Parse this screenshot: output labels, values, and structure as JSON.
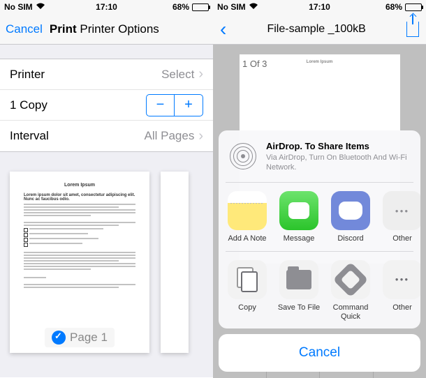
{
  "left": {
    "status": {
      "carrier": "No SIM",
      "time": "17:10",
      "battery": "68%"
    },
    "nav": {
      "cancel": "Cancel",
      "title": "Print",
      "subtitle": "Printer Options"
    },
    "rows": {
      "printer": {
        "label": "Printer",
        "value": "Select"
      },
      "copy": {
        "label": "1 Copy"
      },
      "interval": {
        "label": "Interval",
        "value": "All Pages"
      }
    },
    "preview": {
      "doc_title": "Lorem Ipsum",
      "heading": "Lorem ipsum dolor sit amet, consectetur adipiscing elit. Nunc ac faucibus odio.",
      "badge": "Page 1"
    }
  },
  "right": {
    "status": {
      "carrier": "No SIM",
      "time": "17:10",
      "battery": "68%"
    },
    "nav": {
      "title": "File-sample _100kB"
    },
    "doc": {
      "page_indicator": "1 Of 3",
      "title": "Lorem Ipsum"
    },
    "airdrop": {
      "title": "AirDrop. To Share Items",
      "desc": "Via AirDrop, Turn On Bluetooth And Wi-Fi Network."
    },
    "apps": [
      {
        "name": "Add A Note"
      },
      {
        "name": "Message"
      },
      {
        "name": "Discord"
      },
      {
        "name": "Other"
      }
    ],
    "actions": [
      {
        "name": "Copy"
      },
      {
        "name": "Save To File"
      },
      {
        "name": "Command Quick"
      },
      {
        "name": "Other"
      }
    ],
    "cancel": "Cancel"
  }
}
